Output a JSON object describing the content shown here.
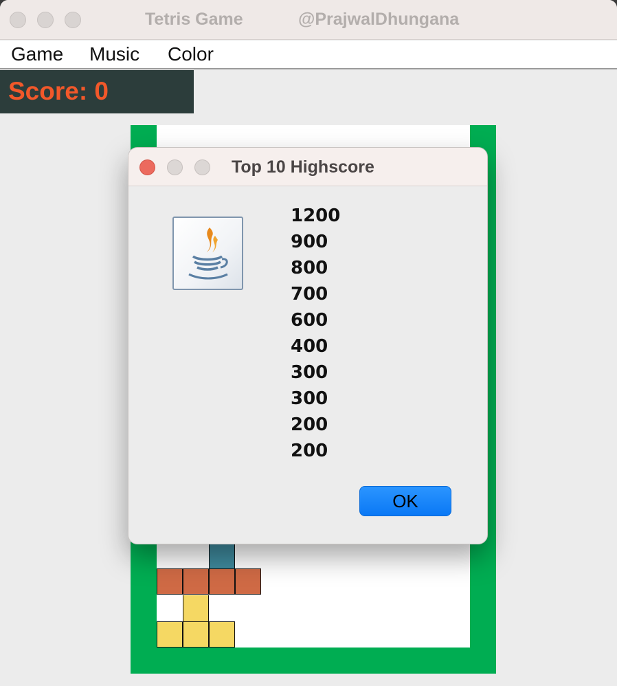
{
  "window": {
    "title_left": "Tetris Game",
    "title_right": "@PrajwalDhungana"
  },
  "menu": {
    "items": [
      "Game",
      "Music",
      "Color"
    ]
  },
  "score": {
    "label": "Score: 0"
  },
  "dialog": {
    "title": "Top 10 Highscore",
    "icon": "java-icon",
    "highscores": [
      "1200",
      "900",
      "800",
      "700",
      "600",
      "400",
      "300",
      "300",
      "200",
      "200"
    ],
    "ok_label": "OK"
  },
  "colors": {
    "board_border": "#00ad52",
    "score_bg": "#2c3d3b",
    "score_text": "#f2582a",
    "block_teal": "#3f8a9d",
    "block_orange": "#cf6a45",
    "block_yellow": "#f5d863",
    "ok_button": "#0a78f5"
  }
}
